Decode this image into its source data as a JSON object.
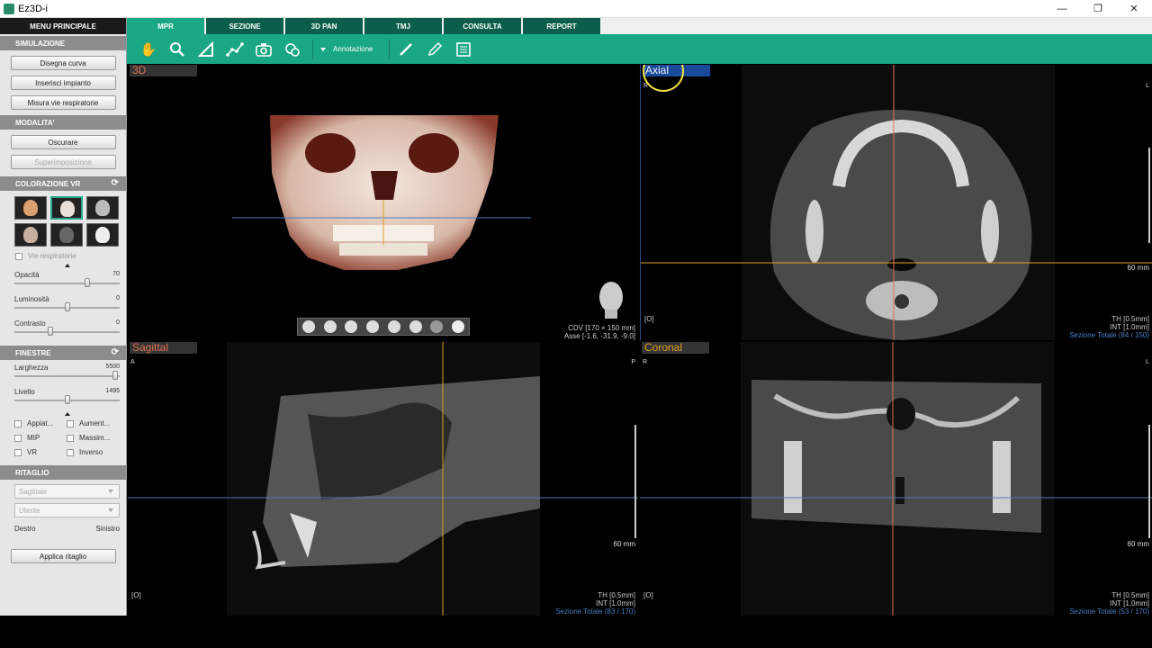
{
  "window": {
    "title": "Ez3D-i",
    "min": "—",
    "max": "❐",
    "close": "✕"
  },
  "sidebar": {
    "header": "MENU PRINCIPALE",
    "simulazione": {
      "title": "SIMULAZIONE",
      "buttons": [
        "Disegna curva",
        "Inserisci impianto",
        "Misura vie respiratorie"
      ]
    },
    "modalita": {
      "title": "MODALITA'",
      "oscurare": "Oscurare",
      "superimposizione": "Superimposizione"
    },
    "colorazione": {
      "title": "COLORAZIONE VR",
      "vie_respiratorie": "Vie respiratorie",
      "opacita": {
        "label": "Opacità",
        "value": "70",
        "level": 0.7
      },
      "luminosita": {
        "label": "Luminosità",
        "value": "0",
        "level": 0.5
      },
      "contrasto": {
        "label": "Contrasto",
        "value": "0",
        "level": 0.33
      }
    },
    "finestre": {
      "title": "FINESTRE",
      "larghezza": {
        "label": "Larghezza",
        "value": "5500",
        "level": 0.98
      },
      "livello": {
        "label": "Livello",
        "value": "1495",
        "level": 0.5
      },
      "checks": [
        "Appiat...",
        "Aument...",
        "MIP",
        "Massim...",
        "VR",
        "Inverso"
      ]
    },
    "ritaglio": {
      "title": "RITAGLIO",
      "select1": "Sagittale",
      "select2": "Utente",
      "destro": "Destro",
      "sinistro": "Sinistro",
      "apply": "Applica ritaglio"
    }
  },
  "tabs": [
    "MPR",
    "SEZIONE",
    "3D PAN",
    "TMJ",
    "CONSULTA",
    "REPORT"
  ],
  "toolbar": {
    "annotation_label": "Annotazione"
  },
  "views": {
    "v3d": {
      "title": "3D",
      "cdv": "CDV [170 × 150 mm]",
      "asse": "Asse [-1.6, -31.9, -9.0]"
    },
    "axial": {
      "title": "Axial",
      "r": "R",
      "l": "L",
      "mm": "60 mm",
      "o": "[O]",
      "th": "TH [0.5mm]",
      "int": "INT [1.0mm]",
      "sez": "Sezione Totale (84 / 150)"
    },
    "sagittal": {
      "title": "Sagittal",
      "a": "A",
      "p": "P",
      "mm": "60 mm",
      "o": "[O]",
      "th": "TH [0.5mm]",
      "int": "INT [1.0mm]",
      "sez": "Sezione Totale (83 / 170)"
    },
    "coronal": {
      "title": "Coronal",
      "r": "R",
      "l": "L",
      "mm": "60 mm",
      "o": "[O]",
      "th": "TH [0.5mm]",
      "int": "INT [1.0mm]",
      "sez": "Sezione Totale (53 / 170)"
    }
  },
  "colors": {
    "accent": "#1aa784",
    "tab_dark": "#0b5e4b",
    "axial": "#f0f0f0",
    "sagittal": "#e07050",
    "coronal": "#e0a020"
  }
}
